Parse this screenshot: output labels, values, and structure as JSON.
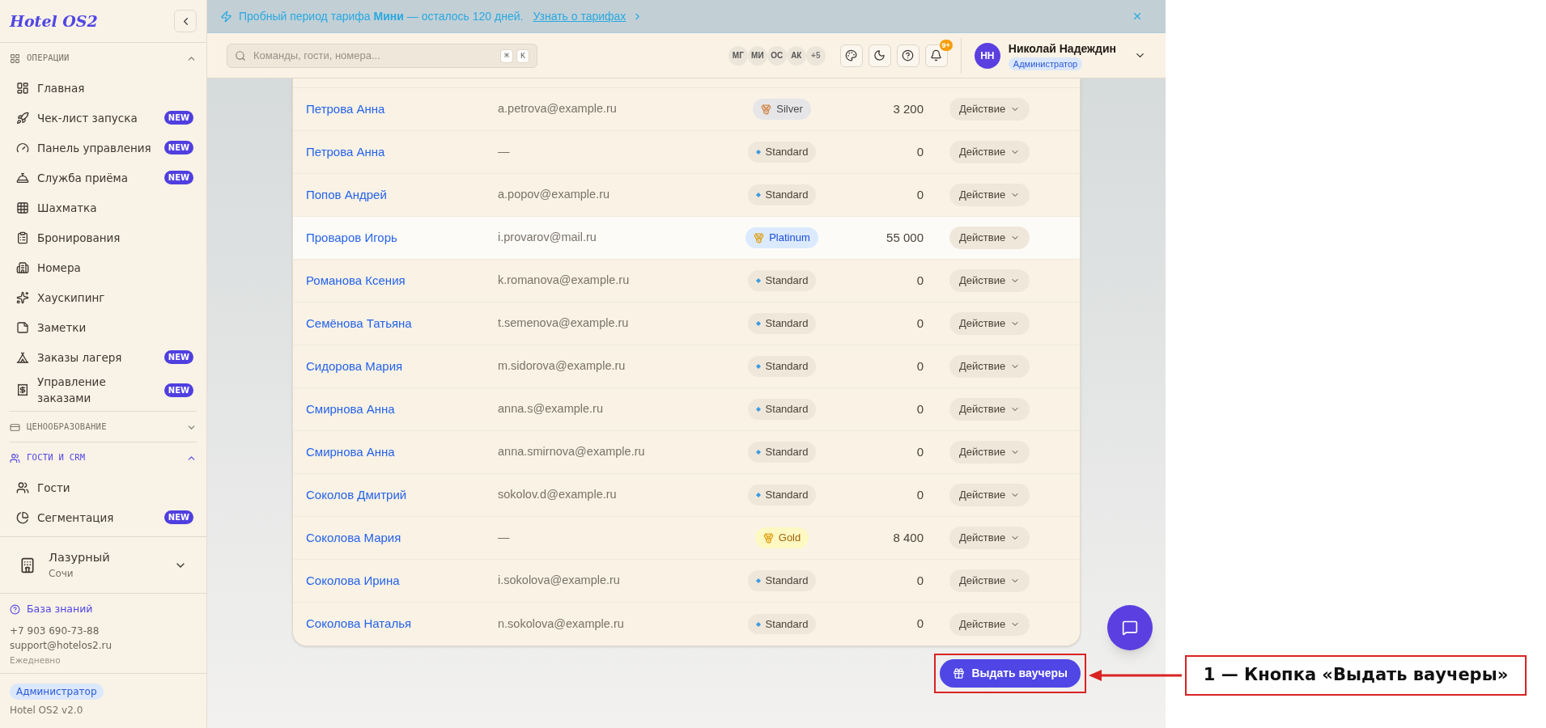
{
  "sidebar": {
    "logo": "Hotel OS2",
    "sections": [
      {
        "label": "ОПЕРАЦИИ",
        "expanded": true,
        "selected": false,
        "items": [
          {
            "label": "Главная"
          },
          {
            "label": "Чек-лист запуска",
            "badge": "NEW"
          },
          {
            "label": "Панель управления",
            "badge": "NEW"
          },
          {
            "label": "Служба приёма",
            "badge": "NEW"
          },
          {
            "label": "Шахматка"
          },
          {
            "label": "Бронирования"
          },
          {
            "label": "Номера"
          },
          {
            "label": "Хаускипинг"
          },
          {
            "label": "Заметки"
          },
          {
            "label": "Заказы лагеря",
            "badge": "NEW"
          },
          {
            "label": "Управление заказами",
            "badge": "NEW"
          }
        ]
      },
      {
        "label": "ЦЕНООБРАЗОВАНИЕ",
        "expanded": false,
        "selected": false
      },
      {
        "label": "ГОСТИ И CRM",
        "expanded": true,
        "selected": true,
        "items": [
          {
            "label": "Гости"
          },
          {
            "label": "Сегментация",
            "badge": "NEW"
          }
        ]
      }
    ],
    "property": {
      "name": "Лазурный",
      "city": "Сочи"
    },
    "support": {
      "link": "База знаний",
      "phone": "+7 903 690-73-88",
      "email": "support@hotelos2.ru",
      "hours": "Ежедневно"
    },
    "footer": {
      "role": "Администратор",
      "version": "Hotel OS2 v2.0"
    }
  },
  "banner": {
    "text": "Пробный период тарифа **Мини** — осталось 120 дней.",
    "link": "Узнать о тарифах"
  },
  "header": {
    "search_placeholder": "Команды, гости, номера...",
    "shortcut": [
      "⌘",
      "K"
    ],
    "avatars": [
      "МГ",
      "МИ",
      "ОС",
      "АК"
    ],
    "avatars_more": "+5",
    "notifications_badge": "9+",
    "user": {
      "initials": "НН",
      "name": "Николай Надеждин",
      "role": "Администратор"
    }
  },
  "table": {
    "rows": [
      {
        "name": "Петрова Анна",
        "email": "a.petrova@example.ru",
        "tier": {
          "kind": "silver",
          "label": "Silver"
        },
        "amount": "3 200",
        "action": "Действие",
        "highlighted": false
      },
      {
        "name": "Петрова Анна",
        "email": "—",
        "tier": {
          "kind": "standard",
          "label": "Standard"
        },
        "amount": "0",
        "action": "Действие",
        "highlighted": false
      },
      {
        "name": "Попов Андрей",
        "email": "a.popov@example.ru",
        "tier": {
          "kind": "standard",
          "label": "Standard"
        },
        "amount": "0",
        "action": "Действие",
        "highlighted": false
      },
      {
        "name": "Проваров Игорь",
        "email": "i.provarov@mail.ru",
        "tier": {
          "kind": "platinum",
          "label": "Platinum"
        },
        "amount": "55 000",
        "action": "Действие",
        "highlighted": true
      },
      {
        "name": "Романова Ксения",
        "email": "k.romanova@example.ru",
        "tier": {
          "kind": "standard",
          "label": "Standard"
        },
        "amount": "0",
        "action": "Действие",
        "highlighted": false
      },
      {
        "name": "Семёнова Татьяна",
        "email": "t.semenova@example.ru",
        "tier": {
          "kind": "standard",
          "label": "Standard"
        },
        "amount": "0",
        "action": "Действие",
        "highlighted": false
      },
      {
        "name": "Сидорова Мария",
        "email": "m.sidorova@example.ru",
        "tier": {
          "kind": "standard",
          "label": "Standard"
        },
        "amount": "0",
        "action": "Действие",
        "highlighted": false
      },
      {
        "name": "Смирнова Анна",
        "email": "anna.s@example.ru",
        "tier": {
          "kind": "standard",
          "label": "Standard"
        },
        "amount": "0",
        "action": "Действие",
        "highlighted": false
      },
      {
        "name": "Смирнова Анна",
        "email": "anna.smirnova@example.ru",
        "tier": {
          "kind": "standard",
          "label": "Standard"
        },
        "amount": "0",
        "action": "Действие",
        "highlighted": false
      },
      {
        "name": "Соколов Дмитрий",
        "email": "sokolov.d@example.ru",
        "tier": {
          "kind": "standard",
          "label": "Standard"
        },
        "amount": "0",
        "action": "Действие",
        "highlighted": false
      },
      {
        "name": "Соколова Мария",
        "email": "—",
        "tier": {
          "kind": "gold",
          "label": "Gold"
        },
        "amount": "8 400",
        "action": "Действие",
        "highlighted": false
      },
      {
        "name": "Соколова Ирина",
        "email": "i.sokolova@example.ru",
        "tier": {
          "kind": "standard",
          "label": "Standard"
        },
        "amount": "0",
        "action": "Действие",
        "highlighted": false
      },
      {
        "name": "Соколова Наталья",
        "email": "n.sokolova@example.ru",
        "tier": {
          "kind": "standard",
          "label": "Standard"
        },
        "amount": "0",
        "action": "Действие",
        "highlighted": false
      }
    ]
  },
  "voucher_button": "Выдать ваучеры",
  "annotation": {
    "label": "1 — Кнопка «Выдать ваучеры»"
  }
}
